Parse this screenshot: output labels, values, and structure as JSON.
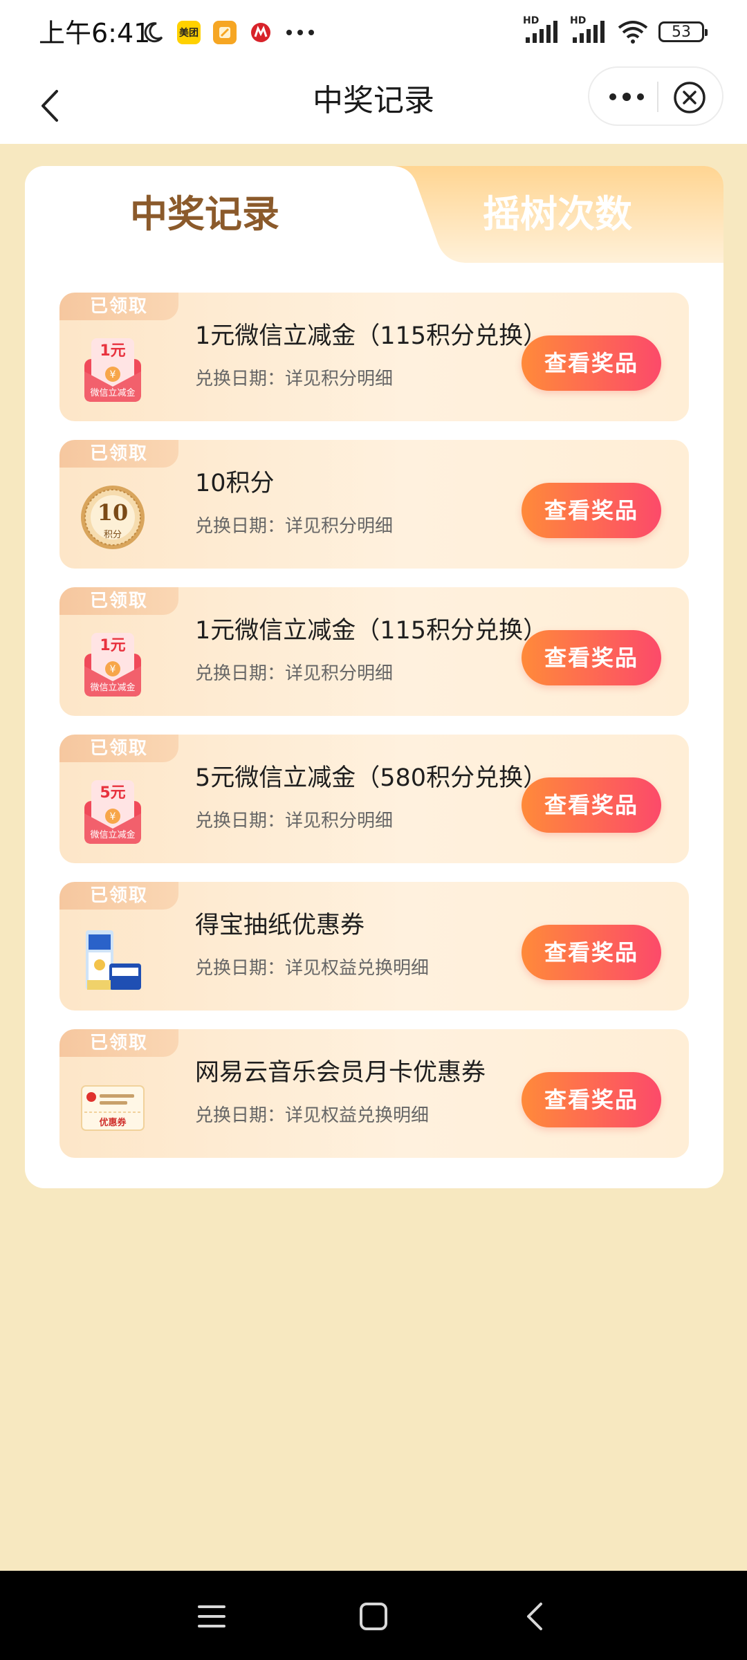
{
  "status_bar": {
    "time": "上午6:41",
    "app_icons": [
      "moon-icon",
      "meituan-app-icon",
      "notes-app-icon",
      "bank-app-icon",
      "more-dots-icon"
    ],
    "meituan_label": "美团",
    "signal_labels": [
      "HD",
      "HD"
    ],
    "battery": "53"
  },
  "nav_bar": {
    "title": "中奖记录"
  },
  "tabs": [
    {
      "label": "中奖记录",
      "active": true
    },
    {
      "label": "摇树次数",
      "active": false
    }
  ],
  "prizes": [
    {
      "tag": "已领取",
      "icon": "wechat-coupon-icon",
      "icon_amount": "1元",
      "icon_caption": "微信立减金",
      "title": "1元微信立减金（115积分兑换）",
      "date": "兑换日期：详见积分明细",
      "button": "查看奖品"
    },
    {
      "tag": "已领取",
      "icon": "points-coin-icon",
      "icon_amount": "10",
      "icon_caption": "积分",
      "title": "10积分",
      "date": "兑换日期：详见积分明细",
      "button": "查看奖品"
    },
    {
      "tag": "已领取",
      "icon": "wechat-coupon-icon",
      "icon_amount": "1元",
      "icon_caption": "微信立减金",
      "title": "1元微信立减金（115积分兑换）",
      "date": "兑换日期：详见积分明细",
      "button": "查看奖品"
    },
    {
      "tag": "已领取",
      "icon": "wechat-coupon-icon",
      "icon_amount": "5元",
      "icon_caption": "微信立减金",
      "title": "5元微信立减金（580积分兑换）",
      "date": "兑换日期：详见积分明细",
      "button": "查看奖品"
    },
    {
      "tag": "已领取",
      "icon": "tissue-product-icon",
      "title": "得宝抽纸优惠券",
      "date": "兑换日期：详见权益兑换明细",
      "button": "查看奖品"
    },
    {
      "tag": "已领取",
      "icon": "coupon-ticket-icon",
      "icon_caption": "优惠券",
      "title": "网易云音乐会员月卡优惠券",
      "date": "兑换日期：详见权益兑换明细",
      "button": "查看奖品"
    }
  ],
  "colors": {
    "page_bg": "#f7e8c0",
    "accent_button_start": "#ff8a3a",
    "accent_button_end": "#fc4a6a",
    "active_tab_text": "#8b5a2b",
    "claimed_tag": "#f6c79f"
  }
}
